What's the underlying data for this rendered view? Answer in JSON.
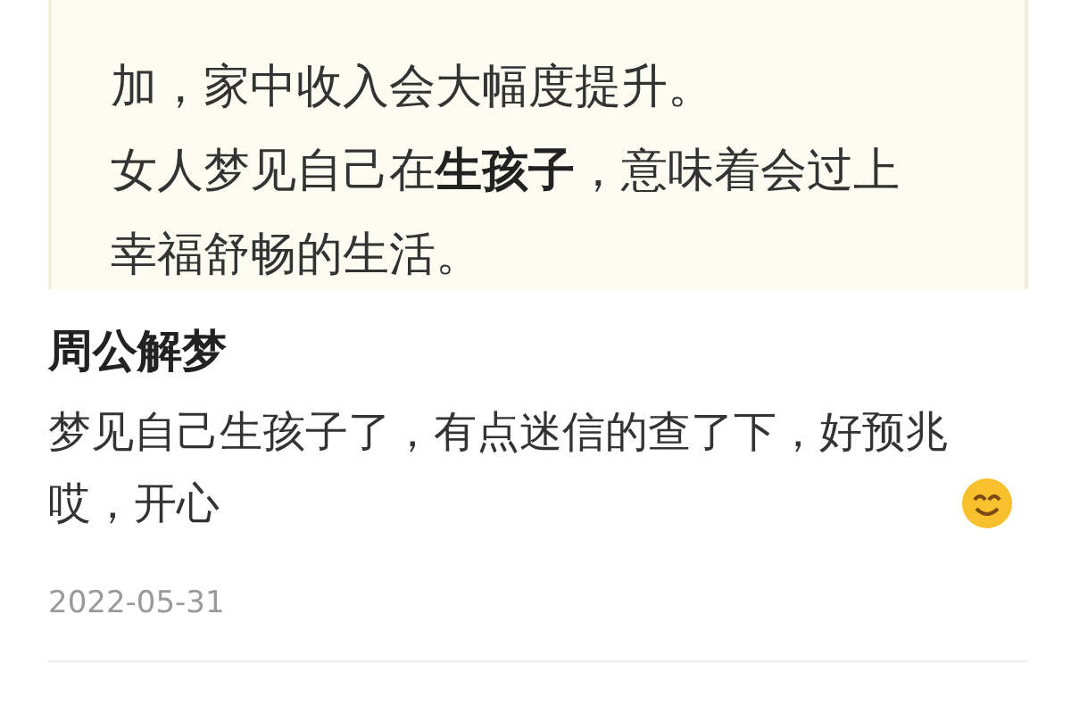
{
  "excerpt": {
    "paragraphs": [
      "加，家中收入会大幅度提升。",
      "女人梦见自己在**生孩子**，意味着会过上幸福舒畅的生活。"
    ]
  },
  "comment": {
    "author": "周公解梦",
    "text": "梦见自己生孩子了，有点迷信的查了下，好预兆哎，开心",
    "date": "2022-05-31"
  }
}
